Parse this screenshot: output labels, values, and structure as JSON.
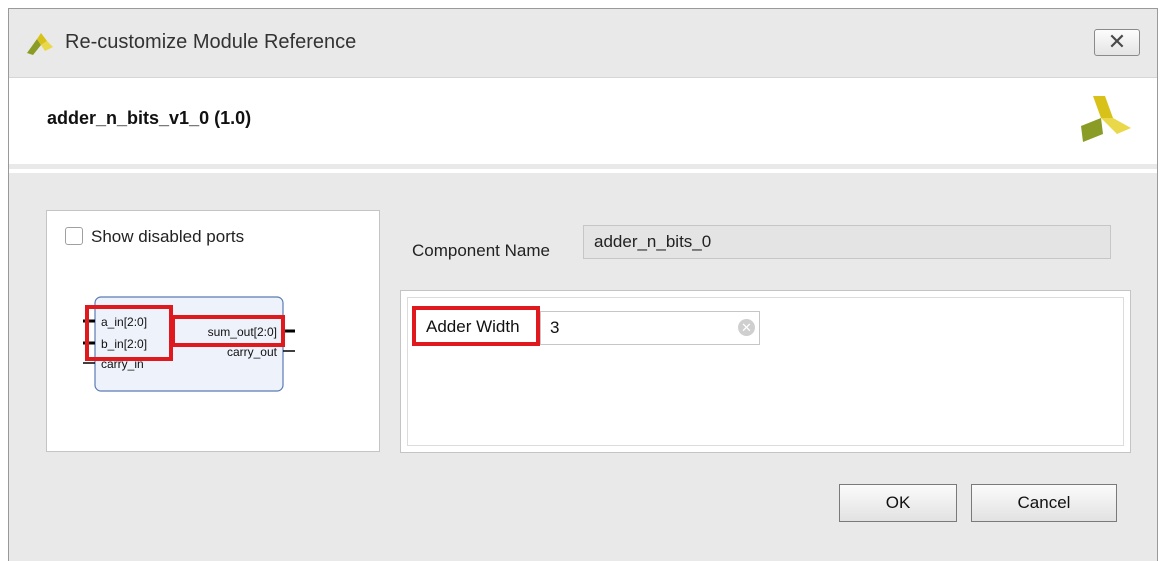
{
  "window": {
    "title": "Re-customize Module Reference",
    "close_glyph": "✕"
  },
  "header": {
    "module_title": "adder_n_bits_v1_0 (1.0)"
  },
  "left_panel": {
    "show_disabled_label": "Show disabled ports",
    "show_disabled_checked": false,
    "ports": {
      "inputs": [
        "a_in[2:0]",
        "b_in[2:0]",
        "carry_in"
      ],
      "outputs": [
        "sum_out[2:0]",
        "carry_out"
      ]
    }
  },
  "component": {
    "label": "Component Name",
    "value": "adder_n_bits_0"
  },
  "params": {
    "adder_width_label": "Adder Width",
    "adder_width_value": "3",
    "clear_glyph": "✕"
  },
  "buttons": {
    "ok": "OK",
    "cancel": "Cancel"
  },
  "colors": {
    "highlight": "#e0191e",
    "logo_yellow": "#d8c21a",
    "logo_green": "#8a9b26",
    "block_border": "#5b7bb5",
    "block_fill": "#eef2fb"
  },
  "icons": {
    "app_logo": "xilinx-logo-icon",
    "close": "close-icon",
    "clear": "clear-icon"
  }
}
